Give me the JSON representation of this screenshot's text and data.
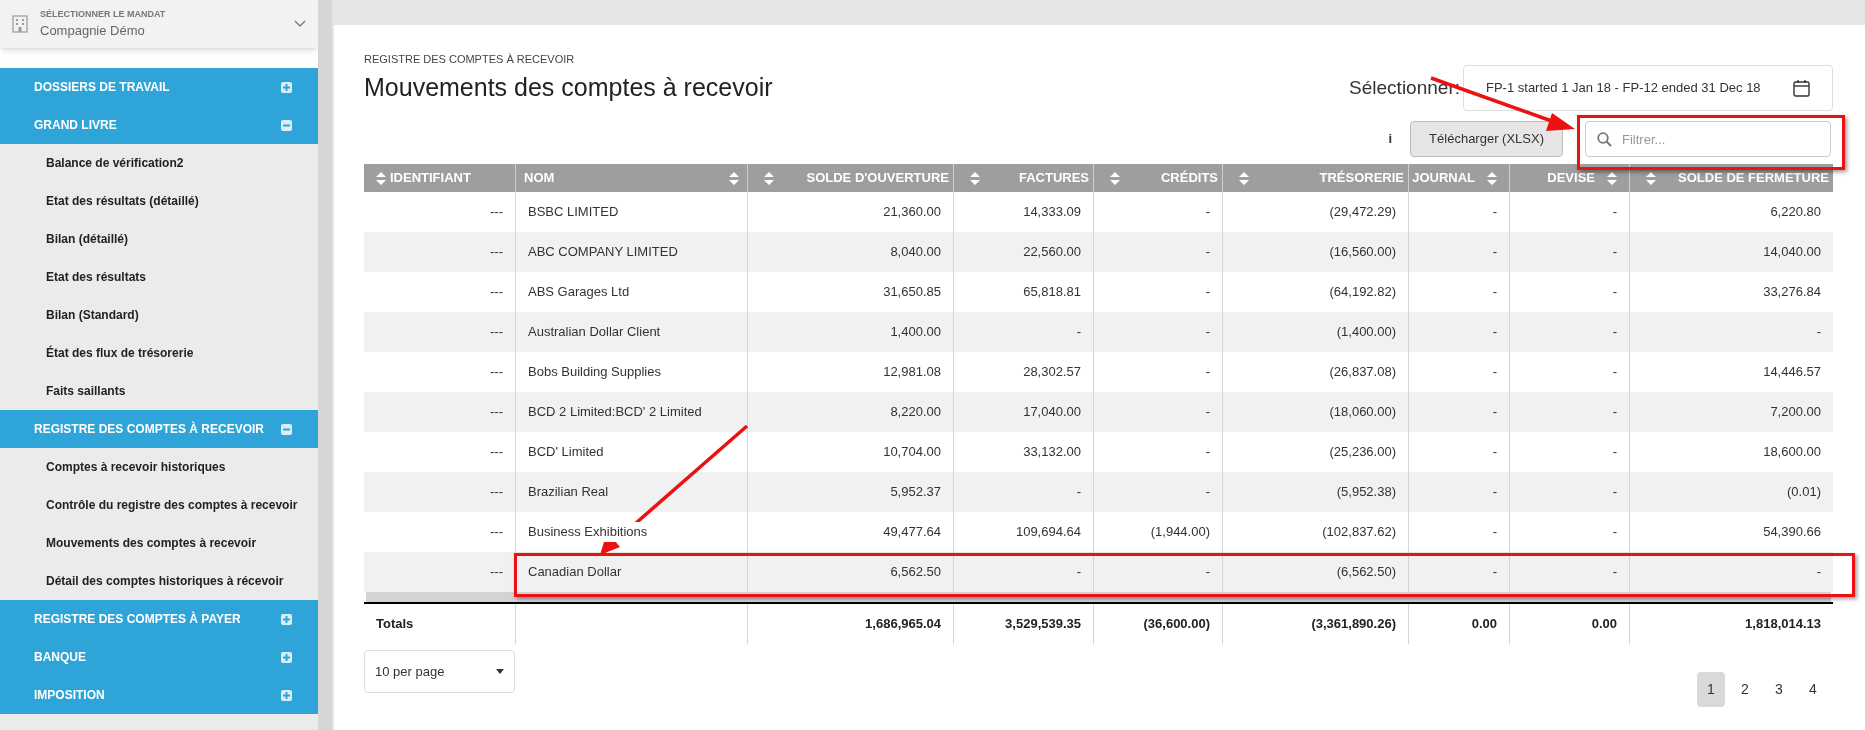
{
  "mandate": {
    "label": "SÉLECTIONNER LE MANDAT",
    "value": "Compagnie Démo"
  },
  "sidebar": [
    {
      "label": "DOSSIERS DE TRAVAIL",
      "expanded": false
    },
    {
      "label": "GRAND LIVRE",
      "expanded": true,
      "children": [
        "Balance de vérification2",
        "Etat des résultats (détaillé)",
        "Bilan (détaillé)",
        "Etat des résultats",
        "Bilan (Standard)",
        "État des flux de trésorerie",
        "Faits saillants"
      ]
    },
    {
      "label": "REGISTRE DES COMPTES À RECEVOIR",
      "expanded": true,
      "children": [
        "Comptes à recevoir historiques",
        "Contrôle du registre des comptes à recevoir",
        "Mouvements des comptes à recevoir",
        "Détail des comptes historiques à récevoir"
      ]
    },
    {
      "label": "REGISTRE DES COMPTES À PAYER",
      "expanded": false
    },
    {
      "label": "BANQUE",
      "expanded": false
    },
    {
      "label": "IMPOSITION",
      "expanded": false
    }
  ],
  "breadcrumb": "REGISTRE DES COMPTES À RECEVOIR",
  "title": "Mouvements des comptes à recevoir",
  "period": {
    "label": "Sélectionner:",
    "value": "FP-1 started 1 Jan 18 - FP-12 ended 31 Dec 18"
  },
  "info": "i",
  "download_button": "Télécharger (XLSX)",
  "filter": {
    "placeholder": "Filtrer..."
  },
  "table": {
    "columns": [
      {
        "label": "IDENTIFIANT",
        "kind": "lead"
      },
      {
        "label": "NOM",
        "kind": "text"
      },
      {
        "label": "SOLDE D'OUVERTURE",
        "kind": "number"
      },
      {
        "label": "FACTURES",
        "kind": "number"
      },
      {
        "label": "CRÉDITS",
        "kind": "number"
      },
      {
        "label": "TRÉSORERIE",
        "kind": "number"
      },
      {
        "label": "JOURNAL",
        "kind": "code"
      },
      {
        "label": "DEVISE",
        "kind": "code"
      },
      {
        "label": "SOLDE DE FERMETURE",
        "kind": "number"
      }
    ],
    "rows": [
      [
        "---",
        "BSBC LIMITED",
        "21,360.00",
        "14,333.09",
        "-",
        "(29,472.29)",
        "-",
        "-",
        "6,220.80"
      ],
      [
        "---",
        "ABC COMPANY LIMITED",
        "8,040.00",
        "22,560.00",
        "-",
        "(16,560.00)",
        "-",
        "-",
        "14,040.00"
      ],
      [
        "---",
        "ABS Garages Ltd",
        "31,650.85",
        "65,818.81",
        "-",
        "(64,192.82)",
        "-",
        "-",
        "33,276.84"
      ],
      [
        "---",
        "Australian Dollar Client",
        "1,400.00",
        "-",
        "-",
        "(1,400.00)",
        "-",
        "-",
        "-"
      ],
      [
        "---",
        "Bobs Building Supplies",
        "12,981.08",
        "28,302.57",
        "-",
        "(26,837.08)",
        "-",
        "-",
        "14,446.57"
      ],
      [
        "---",
        "BCD 2 Limited:BCD' 2 Limited",
        "8,220.00",
        "17,040.00",
        "-",
        "(18,060.00)",
        "-",
        "-",
        "7,200.00"
      ],
      [
        "---",
        "BCD' Limited",
        "10,704.00",
        "33,132.00",
        "-",
        "(25,236.00)",
        "-",
        "-",
        "18,600.00"
      ],
      [
        "---",
        "Brazilian Real",
        "5,952.37",
        "-",
        "-",
        "(5,952.38)",
        "-",
        "-",
        "(0.01)"
      ],
      [
        "---",
        "Business Exhibitions",
        "49,477.64",
        "109,694.64",
        "(1,944.00)",
        "(102,837.62)",
        "-",
        "-",
        "54,390.66"
      ],
      [
        "---",
        "Canadian Dollar",
        "6,562.50",
        "-",
        "-",
        "(6,562.50)",
        "-",
        "-",
        "-"
      ]
    ],
    "totals": {
      "label": "Totals",
      "values": [
        "1,686,965.04",
        "3,529,539.35",
        "(36,600.00)",
        "(3,361,890.26)",
        "0.00",
        "0.00",
        "1,818,014.13"
      ]
    }
  },
  "per_page": "10 per page",
  "pages": [
    {
      "label": "1",
      "selected": true
    },
    {
      "label": "2",
      "selected": false
    },
    {
      "label": "3",
      "selected": false
    },
    {
      "label": "4",
      "selected": false
    }
  ]
}
